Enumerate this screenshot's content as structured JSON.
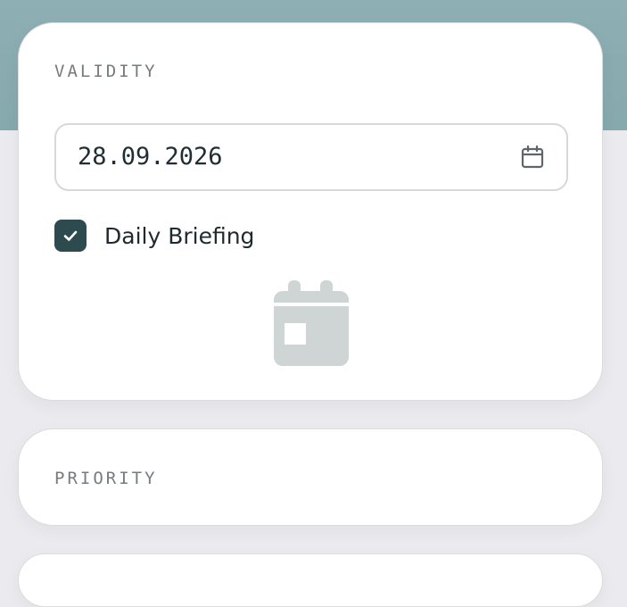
{
  "validity": {
    "section_label": "VALIDITY",
    "date_value": "28.09.2026",
    "daily_briefing_label": "Daily Briefing",
    "daily_briefing_checked": true
  },
  "priority": {
    "section_label": "PRIORITY"
  },
  "icons": {
    "date_picker": "calendar-icon",
    "checkbox_mark": "check-icon",
    "illustration": "calendar-icon"
  },
  "colors": {
    "header_band": "#8eafb3",
    "accent": "#2d4a4f",
    "page_background": "#ebebef",
    "card_background": "#ffffff",
    "label_text": "#767b7e",
    "illustration": "#cfd4d4"
  }
}
